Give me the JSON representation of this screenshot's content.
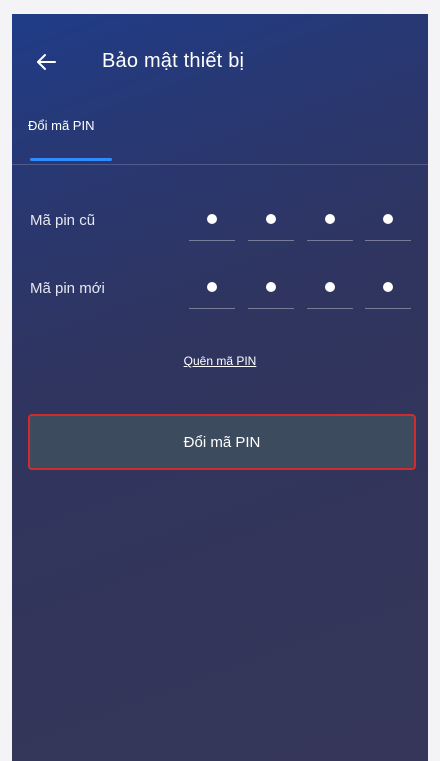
{
  "header": {
    "title": "Bảo mật thiết bị",
    "back_icon": "arrow-left-icon"
  },
  "tabs": [
    {
      "label": "Đổi mã PIN",
      "active": true
    }
  ],
  "form": {
    "old_pin": {
      "label": "Mã pin cũ",
      "mask": "••••"
    },
    "new_pin": {
      "label": "Mã pin mới",
      "mask": "••••"
    }
  },
  "forgot_link": "Quên mã PIN",
  "submit_button": "Đổi mã PIN",
  "colors": {
    "accent": "#2f8cff",
    "button_bg": "#3c4b5e",
    "button_border": "#d22b2b"
  }
}
